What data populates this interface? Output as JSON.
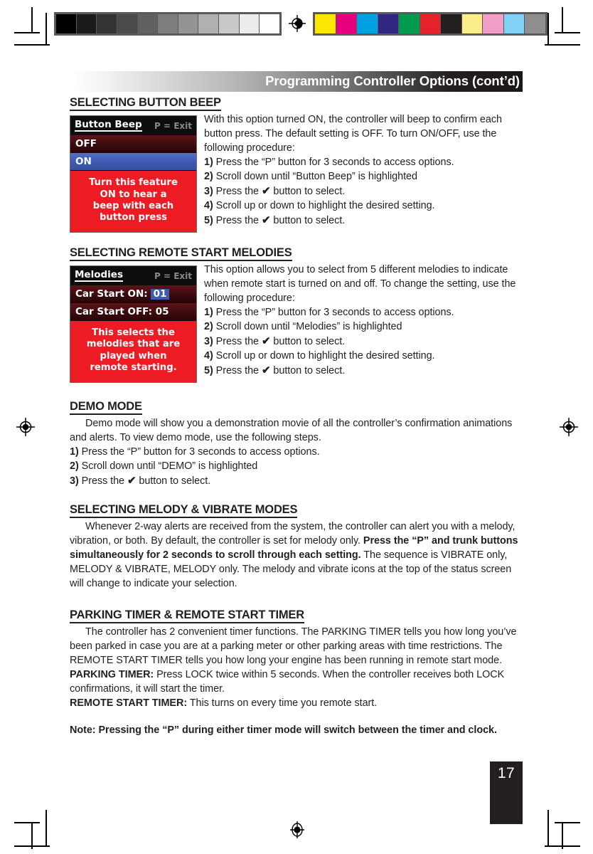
{
  "document": {
    "page_number": "17",
    "header_title": "Programming Controller Options (cont’d)"
  },
  "calibration": {
    "grayscale_patches": [
      "#000000",
      "#1b1b1b",
      "#333333",
      "#4a4a4a",
      "#616161",
      "#7d7d7d",
      "#949494",
      "#b0b0b0",
      "#c8c8c8",
      "#ececec",
      "#ffffff"
    ],
    "color_patches": [
      "#ffe600",
      "#e6007e",
      "#00a0e3",
      "#312783",
      "#009b4d",
      "#e62129",
      "#231f20",
      "#fbee8a",
      "#f29ec8",
      "#7fd2f5",
      "#8e8e8e"
    ]
  },
  "sections": {
    "button_beep": {
      "heading": "SELECTING BUTTON BEEP",
      "lcd": {
        "header_title": "Button Beep",
        "header_exit": "P = Exit",
        "option_1": "OFF",
        "option_2": "ON",
        "desc_line_1": "Turn this feature",
        "desc_line_2": "ON to hear a",
        "desc_line_3": "beep with each",
        "desc_line_4": "button press"
      },
      "intro": "With this option turned ON, the controller will beep to confirm each button press. The default setting is OFF. To turn ON/OFF, use the following procedure:",
      "steps": [
        {
          "num": "1)",
          "text": " Press the “P” button for 3 seconds to access options."
        },
        {
          "num": "2)",
          "text": " Scroll down until “Button Beep” is highlighted"
        },
        {
          "num": "3)",
          "pre": " Press the ",
          "icon": "✔",
          "post": " button to select."
        },
        {
          "num": "4)",
          "text": " Scroll up or down to highlight the desired setting."
        },
        {
          "num": "5)",
          "pre": " Press the ",
          "icon": "✔",
          "post": " button to select."
        }
      ]
    },
    "melodies": {
      "heading": "SELECTING REMOTE START MELODIES",
      "lcd": {
        "header_title": "Melodies",
        "header_exit": "P = Exit",
        "option_1_label": "Car Start ON:",
        "option_1_value": "01",
        "option_2_label": "Car Start OFF: 05",
        "desc_line_1": "This selects the",
        "desc_line_2": "melodies that are",
        "desc_line_3": "played when",
        "desc_line_4": "remote starting."
      },
      "intro": "This option allows you to select from 5 different melodies to indicate when remote start is turned on and off. To change the setting, use the following procedure:",
      "steps": [
        {
          "num": "1)",
          "text": " Press the “P” button for 3 seconds to access options."
        },
        {
          "num": "2)",
          "text": " Scroll down until “Melodies” is highlighted"
        },
        {
          "num": "3)",
          "pre": " Press the ",
          "icon": "✔",
          "post": " button to select."
        },
        {
          "num": "4)",
          "text": " Scroll up or down to highlight the desired setting."
        },
        {
          "num": "5)",
          "pre": " Press the ",
          "icon": "✔",
          "post": " button to select."
        }
      ]
    },
    "demo_mode": {
      "heading": "DEMO MODE",
      "intro": "Demo mode will show you a demonstration movie of all the controller’s confirmation animations and alerts. To view demo mode, use the following steps.",
      "steps": [
        {
          "num": "1)",
          "text": " Press the “P” button for 3 seconds to access options."
        },
        {
          "num": "2)",
          "text": " Scroll down until “DEMO” is highlighted"
        },
        {
          "num": "3)",
          "pre": " Press the ",
          "icon": "✔",
          "post": " button to select."
        }
      ]
    },
    "melody_vibrate": {
      "heading": "SELECTING MELODY & VIBRATE MODES",
      "para_1": "Whenever 2-way alerts are received from the system, the controller can alert you with a melody, vibration, or both. By default, the controller is set for melody only.",
      "bold_lead": "Press the “P” and trunk buttons simultaneously for 2 seconds to scroll through each setting.",
      "para_2": " The sequence is VIBRATE only, MELODY & VIBRATE, MELODY only. The melody and vibrate icons at the top of the status screen will change to indicate your selection."
    },
    "timers": {
      "heading": "PARKING TIMER & REMOTE START TIMER",
      "intro": "The controller has 2 convenient timer functions. The PARKING TIMER tells you how long you’ve been parked in case you are at a parking meter or other parking areas with time restrictions. The REMOTE START TIMER tells you how long your engine has been running in remote start mode.",
      "parking_label": "PARKING TIMER:",
      "parking_text": " Press LOCK twice within 5 seconds. When the controller receives both LOCK confirmations, it will start the timer.",
      "remote_label": "REMOTE START TIMER:",
      "remote_text": " This turns on every time you remote start.",
      "note": "Note: Pressing the “P” during either timer mode will switch between the timer and clock."
    }
  }
}
